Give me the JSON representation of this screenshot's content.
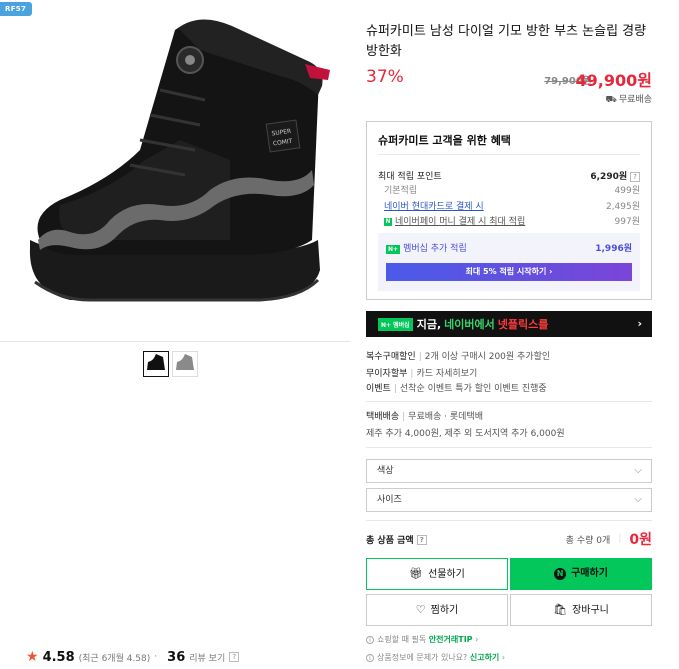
{
  "product": {
    "tag": "RF57",
    "title": "슈퍼카미트 남성 다이얼 기모 방한 부츠 논슬립 경량 방한화",
    "discount": "37%",
    "original_price": "79,900원",
    "price": "49,900원",
    "shipping": "무료배송"
  },
  "benefit": {
    "title": "슈퍼카미트 고객을 위한 혜택",
    "max_points_label": "최대 적립 포인트",
    "max_points_value": "6,290원",
    "rows": [
      {
        "label": "기본적립",
        "value": "499원"
      },
      {
        "label": "네이버 현대카드로 결제 시",
        "value": "2,495원"
      },
      {
        "label": "네이버페이 머니 결제 시 최대 적립",
        "value": "997원"
      }
    ],
    "member_label": "멤버십 추가 적립",
    "member_value": "1,996원",
    "member_button": "최대 5% 적립 시작하기"
  },
  "banner": {
    "badge": "N+ 멤버십",
    "text_a": "지금,",
    "text_b": "네이버에서",
    "text_c": "넷플릭스를"
  },
  "info": [
    {
      "k": "복수구매할인",
      "v": "2개 이상 구매시 200원 추가할인"
    },
    {
      "k": "무이자할부",
      "v": "카드 자세히보기"
    },
    {
      "k": "이벤트",
      "v": "선착순 이벤트 특가 할인 이벤트 진행중"
    }
  ],
  "delivery": {
    "k": "택배배송",
    "v": "무료배송 · 롯데택배",
    "extra": "제주 추가 4,000원, 제주 외 도서지역 추가 6,000원"
  },
  "options": {
    "color": "색상",
    "size": "사이즈"
  },
  "total": {
    "label": "총 상품 금액",
    "qty": "총 수량 0개",
    "amount": "0원"
  },
  "buttons": {
    "gift": "선물하기",
    "buy": "구매하기",
    "wish": "찜하기",
    "cart": "장바구니"
  },
  "notes": {
    "safe_a": "쇼핑할 때 필독",
    "safe_b": "안전거래TIP",
    "report_a": "상품정보에 문제가 있나요?",
    "report_b": "신고하기"
  },
  "rating": {
    "score": "4.58",
    "sub": "(최근 6개월 4.58)",
    "reviews": "36",
    "reviews_label": "리뷰 보기"
  },
  "colors": {
    "accent_green": "#03c75a",
    "price_red": "#e8273c"
  }
}
